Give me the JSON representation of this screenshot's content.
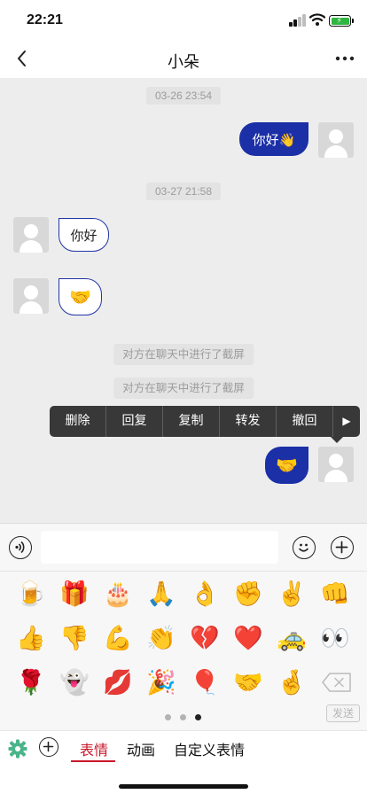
{
  "status": {
    "time": "22:21"
  },
  "nav": {
    "title": "小朵"
  },
  "messages": {
    "ts1": "03-26 23:54",
    "out1": "你好👋",
    "ts2": "03-27 21:58",
    "in1": "你好",
    "in2_emoji": "🤝",
    "sys1": "对方在聊天中进行了截屏",
    "sys2": "对方在聊天中进行了截屏",
    "out2_emoji": "🤝"
  },
  "context_menu": {
    "items": [
      "删除",
      "回复",
      "复制",
      "转发",
      "撤回"
    ],
    "more_glyph": "▶"
  },
  "input": {
    "placeholder": ""
  },
  "emoji_panel": {
    "rows": [
      [
        "🍺",
        "🎁",
        "🎂",
        "🙏",
        "👌",
        "✊",
        "✌️",
        "👊"
      ],
      [
        "👍",
        "👎",
        "💪",
        "👏",
        "💔",
        "❤️",
        "🚕",
        "👀"
      ],
      [
        "🌹",
        "👻",
        "💋",
        "🎉",
        "🎈",
        "🤝",
        "🤞"
      ]
    ],
    "backspace_glyph": "✕",
    "send_label": "发送",
    "page_count": 3,
    "active_page": 3
  },
  "tabs": {
    "items": [
      "表情",
      "动画",
      "自定义表情"
    ],
    "active": "表情"
  },
  "colors": {
    "outgoing_bubble": "#1b2fa7",
    "incoming_border": "#2135a6",
    "active_tab": "#c9162a",
    "chat_bg": "#ededed"
  }
}
